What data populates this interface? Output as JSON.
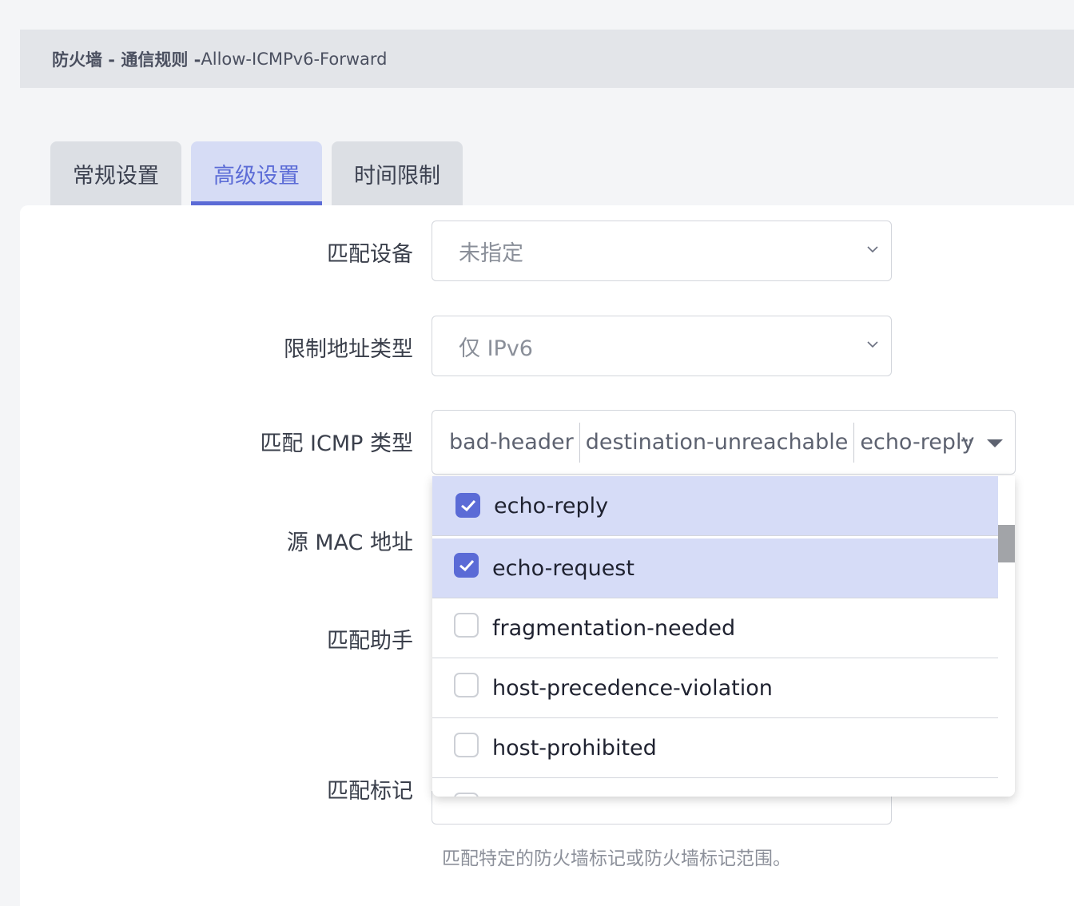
{
  "breadcrumb": {
    "strong": "防火墙 - 通信规则 - ",
    "rest": "Allow-ICMPv6-Forward"
  },
  "tabs": [
    {
      "label": "常规设置",
      "active": false
    },
    {
      "label": "高级设置",
      "active": true
    },
    {
      "label": "时间限制",
      "active": false
    }
  ],
  "form": {
    "match_device": {
      "label": "匹配设备",
      "value": "未指定"
    },
    "address_type": {
      "label": "限制地址类型",
      "value": "仅 IPv6"
    },
    "icmp_type": {
      "label": "匹配 ICMP 类型",
      "chips": [
        "bad-header",
        "destination-unreachable",
        "echo-reply"
      ],
      "more": "···",
      "options": [
        {
          "label": "echo-reply",
          "checked": true
        },
        {
          "label": "echo-request",
          "checked": true
        },
        {
          "label": "fragmentation-needed",
          "checked": false
        },
        {
          "label": "host-precedence-violation",
          "checked": false
        },
        {
          "label": "host-prohibited",
          "checked": false
        }
      ]
    },
    "src_mac": {
      "label": "源 MAC 地址"
    },
    "helper": {
      "label": "匹配助手"
    },
    "mark": {
      "label": "匹配标记",
      "hint": "匹配特定的防火墙标记或防火墙标记范围。"
    }
  },
  "colors": {
    "accent": "#5b6bd6",
    "selected_row": "#d6dcf7"
  }
}
